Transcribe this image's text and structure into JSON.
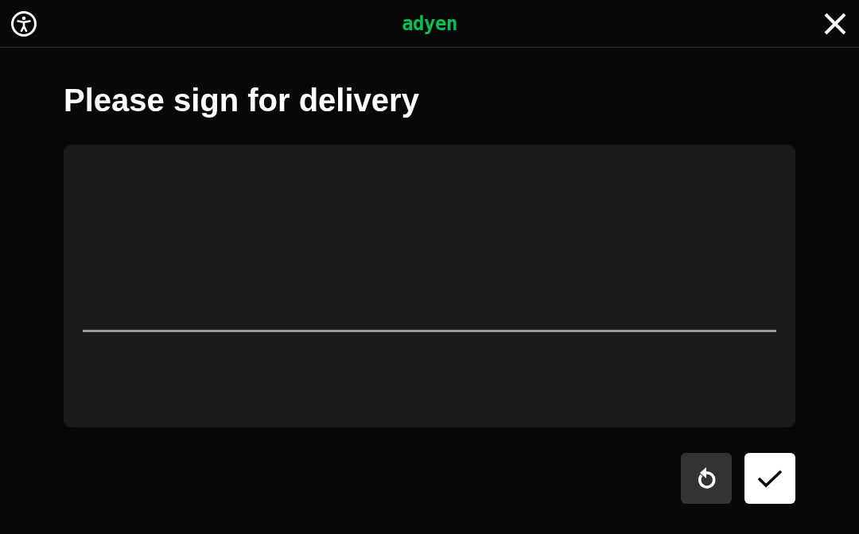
{
  "header": {
    "logo": "adyen"
  },
  "title": "Please sign for delivery",
  "signature_pad": {
    "kind": "signature"
  },
  "buttons": [
    {
      "kind": "reset"
    },
    {
      "kind": "confirm"
    }
  ]
}
